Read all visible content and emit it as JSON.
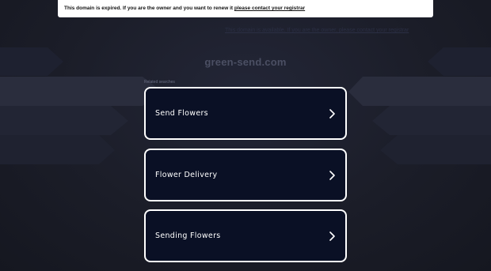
{
  "notice": {
    "text": "This domain is expired. If you are the owner and you want to renew it",
    "link": "please contact your registrar"
  },
  "inquiry": {
    "text": "This domain is available. If you are the owner, please contact your registrar"
  },
  "domain": {
    "name": "green-send.com"
  },
  "related": {
    "label": "Related searches"
  },
  "results": [
    {
      "label": "Send Flowers",
      "icon": "chevron-right-icon"
    },
    {
      "label": "Flower Delivery",
      "icon": "chevron-right-icon"
    },
    {
      "label": "Sending Flowers",
      "icon": "chevron-right-icon"
    }
  ],
  "colors": {
    "background": "#1a1c27",
    "card_background": "#0a1025",
    "card_border": "#ffffff",
    "notice_background": "#ffffff"
  }
}
